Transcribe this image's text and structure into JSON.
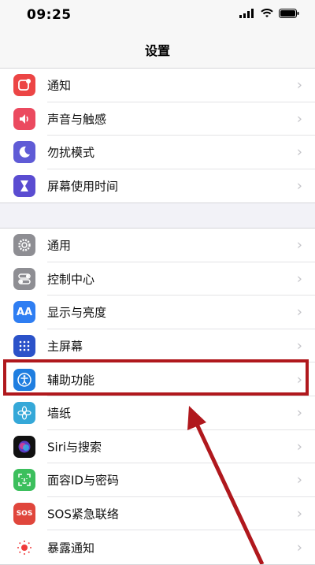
{
  "status_bar": {
    "time": "09:25"
  },
  "nav": {
    "title": "设置"
  },
  "group1": [
    {
      "label": "通知",
      "icon": "notifications-icon",
      "color": "#ec4545"
    },
    {
      "label": "声音与触感",
      "icon": "sounds-icon",
      "color": "#eb4a5f"
    },
    {
      "label": "勿扰模式",
      "icon": "moon-icon",
      "color": "#5f5bd6"
    },
    {
      "label": "屏幕使用时间",
      "icon": "hourglass-icon",
      "color": "#5a4cd1"
    }
  ],
  "group2": [
    {
      "label": "通用",
      "icon": "gear-icon",
      "color": "#8e8e93"
    },
    {
      "label": "控制中心",
      "icon": "toggles-icon",
      "color": "#8e8e93"
    },
    {
      "label": "显示与亮度",
      "icon": "display-icon",
      "color": "#2f7ef2",
      "text": "AA"
    },
    {
      "label": "主屏幕",
      "icon": "home-screen-icon",
      "color": "#2b52c9"
    },
    {
      "label": "辅助功能",
      "icon": "accessibility-icon",
      "color": "#1f7ee0"
    },
    {
      "label": "墙纸",
      "icon": "wallpaper-icon",
      "color": "#35a8d8"
    },
    {
      "label": "Siri与搜索",
      "icon": "siri-icon",
      "color": "#111111"
    },
    {
      "label": "面容ID与密码",
      "icon": "face-id-icon",
      "color": "#3cbf5d"
    },
    {
      "label": "SOS紧急联络",
      "icon": "sos-icon",
      "color": "#e0463c",
      "text": "SOS"
    },
    {
      "label": "暴露通知",
      "icon": "exposure-icon",
      "color": "#ffffff"
    }
  ],
  "annotation_color": "#b0181d"
}
